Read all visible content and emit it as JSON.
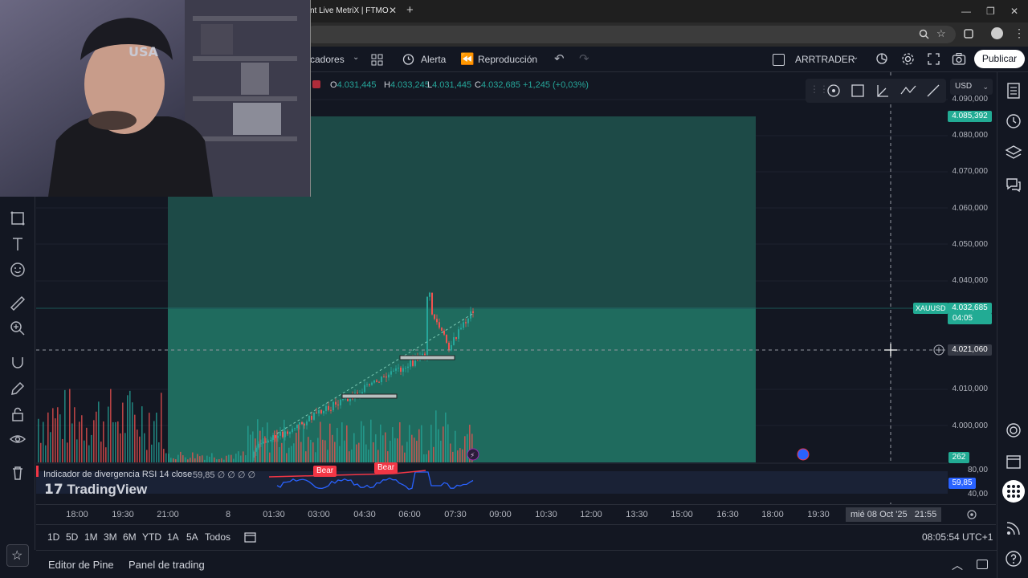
{
  "browser": {
    "tab_title": "nt Live MetriX | FTMO",
    "new_tab": "+",
    "window_controls": [
      "—",
      "❐",
      "✕"
    ]
  },
  "toolbar": {
    "indicators_label": "cadores",
    "alert_label": "Alerta",
    "replay_label": "Reproducción",
    "layout_name": "ARRTRADER",
    "publish_label": "Publicar"
  },
  "ohlc": {
    "open": "4.031,445",
    "high": "4.033,245",
    "low": "4.031,445",
    "close": "4.032,685",
    "change": "+1,245 (+0,03%)",
    "labels": {
      "o": "O",
      "h": "H",
      "l": "L",
      "c": "C"
    }
  },
  "currency_select": "USD",
  "price_axis": {
    "ticks": [
      "4.090,000",
      "4.080,000",
      "4.070,000",
      "4.060,000",
      "4.050,000",
      "4.040,000",
      "4.010,000",
      "4.000,000"
    ],
    "target_label": "4.085,392",
    "symbol_label": "XAUUSD",
    "last_price": "4.032,685",
    "countdown": "04:05",
    "crosshair_price": "4.021,060",
    "volume_label": "262",
    "rsi_ticks": [
      "80,00",
      "40,00"
    ],
    "rsi_value": "59,85"
  },
  "indicator": {
    "name": "Indicador de divergencia RSI 14 close",
    "values": "59,85  ∅ ∅ ∅ ∅",
    "bear_labels": [
      "Bear",
      "Bear"
    ]
  },
  "brand": "TradingView",
  "time_axis": {
    "ticks": [
      "18:00",
      "19:30",
      "21:00",
      "8",
      "01:30",
      "03:00",
      "04:30",
      "06:00",
      "07:30",
      "09:00",
      "10:30",
      "12:00",
      "13:30",
      "15:00",
      "16:30",
      "18:00",
      "19:30"
    ],
    "crosshair_time": "mié 08 Oct '25   21:55"
  },
  "ranges": [
    "1D",
    "5D",
    "1M",
    "3M",
    "6M",
    "YTD",
    "1A",
    "5A",
    "Todos"
  ],
  "clock": "08:05:54 UTC+1",
  "bottom_tabs": {
    "pine": "Editor de Pine",
    "trading": "Panel de trading"
  },
  "colors": {
    "background": "#131722",
    "zone_upper": "#1d4a47",
    "zone_lower": "#1f6b5e",
    "up": "#26a69a",
    "down": "#ef5350",
    "rsi_line": "#2962ff",
    "bear": "#f23645"
  },
  "icons": {
    "left_tools": [
      "rectangle-icon",
      "text-icon",
      "emoji-icon",
      "ruler-icon",
      "zoom-in-icon",
      "magnet-icon",
      "pencil-lock-icon",
      "lock-icon",
      "eye-icon",
      "trash-icon"
    ],
    "right_tools": [
      "watchlist-icon",
      "alerts-clock-icon",
      "layers-icon",
      "chat-icon",
      "target-icon",
      "calendar-icon",
      "apps-icon",
      "broadcast-icon",
      "help-icon"
    ]
  }
}
